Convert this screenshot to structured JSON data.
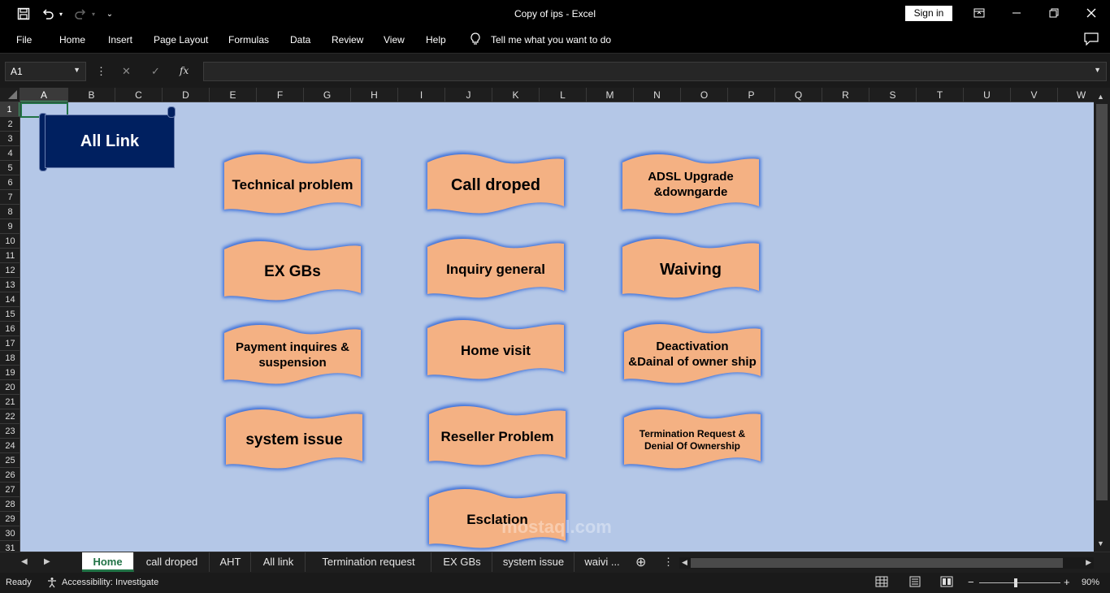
{
  "titlebar": {
    "document": "Copy of ips",
    "separator": " - ",
    "app": "Excel",
    "signin_label": "Sign in"
  },
  "ribbon": {
    "tabs": [
      "File",
      "Home",
      "Insert",
      "Page Layout",
      "Formulas",
      "Data",
      "Review",
      "View",
      "Help"
    ],
    "tell_me": "Tell me what you want to do"
  },
  "formula_bar": {
    "name_box": "A1",
    "fx_label": "fx",
    "value": ""
  },
  "columns": [
    "A",
    "B",
    "C",
    "D",
    "E",
    "F",
    "G",
    "H",
    "I",
    "J",
    "K",
    "L",
    "M",
    "N",
    "O",
    "P",
    "Q",
    "R",
    "S",
    "T",
    "U",
    "V",
    "W"
  ],
  "rows": [
    "1",
    "2",
    "3",
    "4",
    "5",
    "6",
    "7",
    "8",
    "9",
    "10",
    "11",
    "12",
    "13",
    "14",
    "15",
    "16",
    "17",
    "18",
    "19",
    "20",
    "21",
    "22",
    "23",
    "24",
    "25",
    "26",
    "27",
    "28",
    "29",
    "30",
    "31"
  ],
  "selected_cell": {
    "column": "A",
    "row": "1"
  },
  "sheet": {
    "background": "#b4c7e7",
    "all_link": "All Link",
    "buttons": [
      "Technical problem",
      "Call droped",
      "ADSL Upgrade\n&downgarde",
      "EX GBs",
      "Inquiry general",
      "Waiving",
      "Payment inquires &\nsuspension",
      "Home visit",
      "Deactivation\n&Dainal of owner ship",
      "system issue",
      "Reseller Problem",
      "Termination Request &\nDenial Of Ownership",
      "Esclation"
    ],
    "button_fill": "#f4b183"
  },
  "sheet_tabs": [
    "Home",
    "call droped",
    "AHT",
    "All link",
    "Termination request",
    "EX GBs",
    "system issue",
    "waivi ..."
  ],
  "status": {
    "ready": "Ready",
    "accessibility": "Accessibility: Investigate",
    "zoom": "90%"
  },
  "watermark": "mostaql.com",
  "accent": "#217346"
}
